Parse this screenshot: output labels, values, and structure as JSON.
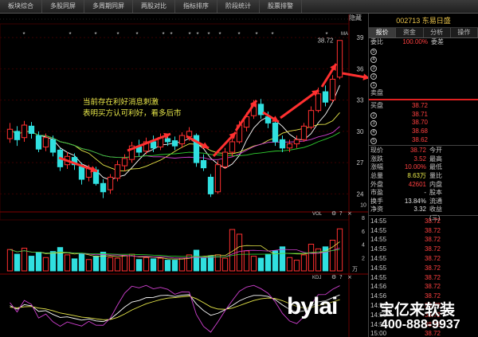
{
  "tabbar": {
    "tabs": [
      "板块综合",
      "多股同屏",
      "多周期同屏",
      "两股对比",
      "指标排序",
      "阶段统计",
      "股票排警"
    ]
  },
  "hide_label": "隐藏",
  "chart": {
    "annotation_line1": "当前存在利好消息刺激",
    "annotation_line2": "表明买方认可利好，看多后市",
    "price_ticks": [
      "39",
      "36",
      "33",
      "30",
      "27",
      "24"
    ],
    "high_label": "38.72",
    "vol_label": "VOL",
    "vol_unit": "万",
    "kdj_label": "KDJ",
    "ma_label": "MA",
    "vol_ticks": [
      "10",
      "8",
      "6",
      "4",
      "2"
    ],
    "panel_icons": [
      "⚙",
      "?",
      "×"
    ]
  },
  "chart_data": {
    "type": "candlestick",
    "candles": [
      {
        "o": 29.3,
        "c": 30.2,
        "h": 30.8,
        "l": 28.9
      },
      {
        "o": 30.0,
        "c": 29.2,
        "h": 30.5,
        "l": 28.6
      },
      {
        "o": 29.4,
        "c": 30.6,
        "h": 31.0,
        "l": 29.0
      },
      {
        "o": 30.5,
        "c": 29.8,
        "h": 30.9,
        "l": 29.3
      },
      {
        "o": 29.6,
        "c": 28.3,
        "h": 30.0,
        "l": 28.0
      },
      {
        "o": 28.5,
        "c": 29.4,
        "h": 29.8,
        "l": 28.1
      },
      {
        "o": 29.2,
        "c": 28.0,
        "h": 29.6,
        "l": 27.6
      },
      {
        "o": 28.2,
        "c": 26.6,
        "h": 28.4,
        "l": 26.2
      },
      {
        "o": 26.8,
        "c": 27.6,
        "h": 28.0,
        "l": 26.4
      },
      {
        "o": 27.5,
        "c": 26.8,
        "h": 27.9,
        "l": 26.3
      },
      {
        "o": 26.6,
        "c": 25.4,
        "h": 27.0,
        "l": 24.9
      },
      {
        "o": 25.6,
        "c": 26.5,
        "h": 26.8,
        "l": 25.2
      },
      {
        "o": 26.3,
        "c": 25.0,
        "h": 26.6,
        "l": 24.8
      },
      {
        "o": 25.0,
        "c": 24.2,
        "h": 25.4,
        "l": 23.6
      },
      {
        "o": 24.4,
        "c": 25.6,
        "h": 25.9,
        "l": 24.0
      },
      {
        "o": 25.5,
        "c": 26.8,
        "h": 27.2,
        "l": 25.2
      },
      {
        "o": 26.7,
        "c": 27.4,
        "h": 27.8,
        "l": 26.2
      },
      {
        "o": 27.3,
        "c": 28.6,
        "h": 29.0,
        "l": 27.0
      },
      {
        "o": 28.5,
        "c": 28.0,
        "h": 29.2,
        "l": 27.6
      },
      {
        "o": 28.1,
        "c": 29.0,
        "h": 29.4,
        "l": 27.8
      },
      {
        "o": 29.0,
        "c": 28.4,
        "h": 29.6,
        "l": 28.0
      },
      {
        "o": 28.5,
        "c": 29.4,
        "h": 29.8,
        "l": 28.2
      },
      {
        "o": 29.3,
        "c": 29.0,
        "h": 29.8,
        "l": 28.6
      },
      {
        "o": 29.1,
        "c": 28.6,
        "h": 29.5,
        "l": 28.2
      },
      {
        "o": 28.8,
        "c": 29.6,
        "h": 29.9,
        "l": 28.4
      },
      {
        "o": 29.5,
        "c": 30.0,
        "h": 30.4,
        "l": 29.1
      },
      {
        "o": 29.6,
        "c": 27.0,
        "h": 29.8,
        "l": 26.6
      },
      {
        "o": 27.2,
        "c": 26.5,
        "h": 27.8,
        "l": 26.2
      },
      {
        "o": 25.6,
        "c": 24.0,
        "h": 25.9,
        "l": 23.7
      },
      {
        "o": 24.2,
        "c": 26.8,
        "h": 27.2,
        "l": 24.0
      },
      {
        "o": 26.6,
        "c": 28.0,
        "h": 28.4,
        "l": 26.4
      },
      {
        "o": 28.0,
        "c": 29.0,
        "h": 29.4,
        "l": 27.6
      },
      {
        "o": 29.0,
        "c": 30.6,
        "h": 31.0,
        "l": 28.8
      },
      {
        "o": 30.4,
        "c": 31.4,
        "h": 31.8,
        "l": 30.0
      },
      {
        "o": 31.5,
        "c": 32.6,
        "h": 33.0,
        "l": 31.2
      },
      {
        "o": 32.6,
        "c": 31.6,
        "h": 33.1,
        "l": 31.2
      },
      {
        "o": 31.4,
        "c": 30.8,
        "h": 31.9,
        "l": 30.3
      },
      {
        "o": 30.8,
        "c": 29.0,
        "h": 31.0,
        "l": 28.6
      },
      {
        "o": 29.2,
        "c": 28.4,
        "h": 29.6,
        "l": 28.0
      },
      {
        "o": 28.4,
        "c": 28.8,
        "h": 29.2,
        "l": 28.0
      },
      {
        "o": 28.8,
        "c": 29.2,
        "h": 29.6,
        "l": 28.4
      },
      {
        "o": 29.2,
        "c": 30.5,
        "h": 30.8,
        "l": 29.0
      },
      {
        "o": 30.4,
        "c": 32.0,
        "h": 32.4,
        "l": 30.2
      },
      {
        "o": 32.0,
        "c": 33.6,
        "h": 34.2,
        "l": 31.8
      },
      {
        "o": 33.8,
        "c": 32.8,
        "h": 34.4,
        "l": 32.4
      },
      {
        "o": 33.0,
        "c": 35.0,
        "h": 35.4,
        "l": 32.8
      },
      {
        "o": 35.2,
        "c": 38.72,
        "h": 38.72,
        "l": 35.0
      }
    ],
    "volume": [
      3.2,
      2.5,
      3.4,
      2.2,
      2.8,
      2.0,
      2.9,
      3.5,
      2.4,
      1.8,
      2.6,
      1.7,
      2.2,
      2.8,
      2.0,
      1.9,
      2.3,
      2.5,
      1.7,
      2.0,
      1.8,
      1.9,
      1.6,
      1.6,
      1.9,
      2.4,
      3.1,
      1.9,
      2.2,
      2.4,
      1.9,
      6.2,
      5.5,
      3.0,
      2.2,
      1.9,
      2.5,
      3.0,
      3.6,
      2.0,
      1.6,
      2.4,
      4.0,
      3.3,
      3.6,
      4.6,
      6.3
    ],
    "ylim": [
      22.5,
      40
    ],
    "vol_ylim": [
      0,
      8
    ]
  },
  "panel": {
    "title": "002713 东易日盛",
    "subtabs": [
      "报价",
      "资金",
      "分析",
      "操作"
    ],
    "weibi_label": "委比",
    "weibi_value": "100.00%",
    "weicha_label": "委差",
    "sell_rows": [
      {
        "n": "5",
        "price": "",
        "vol": ""
      },
      {
        "n": "4",
        "price": "",
        "vol": ""
      },
      {
        "n": "3",
        "price": "",
        "vol": ""
      },
      {
        "n": "2",
        "price": "",
        "vol": ""
      },
      {
        "n": "1",
        "price": "",
        "vol": ""
      }
    ],
    "sell_label": "卖盘",
    "buy_label": "买盘",
    "buy_rows": [
      {
        "n": "1",
        "price": "38.72"
      },
      {
        "n": "2",
        "price": "38.71"
      },
      {
        "n": "3",
        "price": "38.70"
      },
      {
        "n": "4",
        "price": "38.68"
      },
      {
        "n": "5",
        "price": "38.62"
      }
    ],
    "quote": [
      {
        "l1": "现价",
        "v1": "38.72",
        "l2": "今开",
        "v2": ""
      },
      {
        "l1": "涨跌",
        "v1": "3.52",
        "l2": "最高",
        "v2": ""
      },
      {
        "l1": "涨幅",
        "v1": "10.00%",
        "l2": "最低",
        "v2": ""
      },
      {
        "l1": "总量",
        "v1": "8.63万",
        "l2": "量比",
        "v2": ""
      },
      {
        "l1": "外盘",
        "v1": "42601",
        "l2": "内盘",
        "v2": ""
      },
      {
        "l1": "市盈",
        "v1": "-",
        "l2": "股本",
        "v2": ""
      },
      {
        "l1": "换手",
        "v1": "13.84%",
        "l2": "流通",
        "v2": ""
      },
      {
        "l1": "净资",
        "v1": "3.32",
        "l2": "收益(三)",
        "v2": ""
      }
    ],
    "trades": [
      {
        "t": "14:55",
        "p": "38.72"
      },
      {
        "t": "14:55",
        "p": "38.72"
      },
      {
        "t": "14:55",
        "p": "38.72"
      },
      {
        "t": "14:55",
        "p": "38.72"
      },
      {
        "t": "14:55",
        "p": "38.72"
      },
      {
        "t": "14:55",
        "p": "38.72"
      },
      {
        "t": "14:55",
        "p": "38.72"
      },
      {
        "t": "14:56",
        "p": "38.72"
      },
      {
        "t": "14:56",
        "p": "38.72"
      },
      {
        "t": "14:56",
        "p": "38.72"
      },
      {
        "t": "14:56",
        "p": "38.72"
      },
      {
        "t": "14:56",
        "p": "38.72"
      },
      {
        "t": "15:00",
        "p": "38.72"
      }
    ]
  },
  "watermark": {
    "brand": "bylai",
    "cn": "宝亿来软装",
    "tel": "400-888-9937"
  },
  "colors": {
    "up": "#ff3030",
    "down": "#30e0e0",
    "ma5": "#ffffff",
    "ma10": "#e8e84a",
    "ma20": "#d040d0",
    "ma30": "#30d030",
    "arrow": "#ff3030"
  }
}
